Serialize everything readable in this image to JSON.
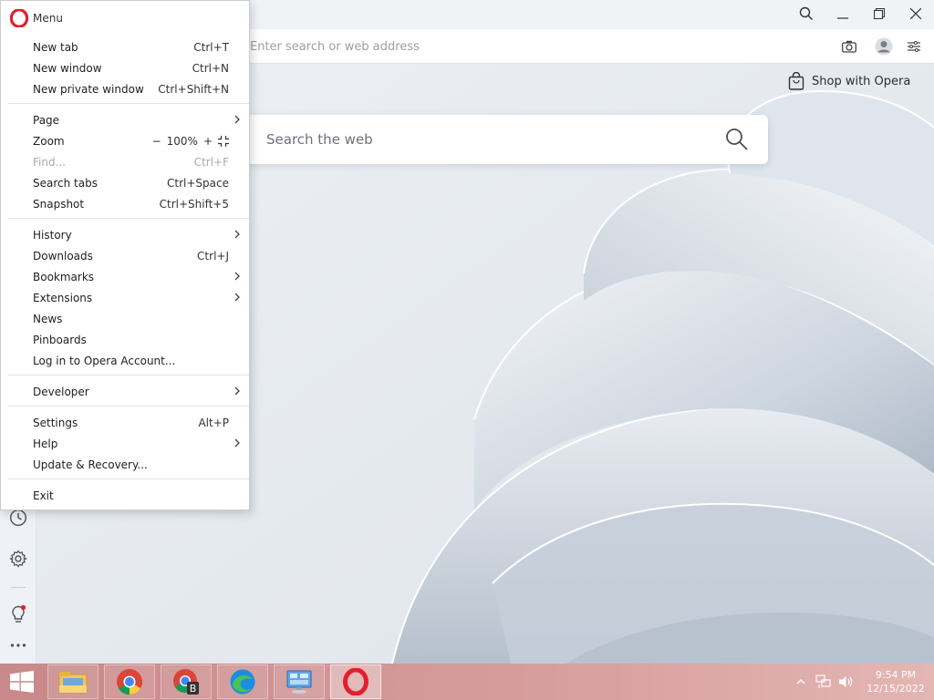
{
  "browser": {
    "address_placeholder": "Enter search or web address",
    "shop_label": "Shop with Opera",
    "search_placeholder": "Search the web"
  },
  "menu": {
    "title": "Menu",
    "items": [
      {
        "label": "New tab",
        "shortcut": "Ctrl+T"
      },
      {
        "label": "New window",
        "shortcut": "Ctrl+N"
      },
      {
        "label": "New private window",
        "shortcut": "Ctrl+Shift+N"
      },
      {
        "label": "Page",
        "submenu": true
      },
      {
        "label": "Zoom",
        "zoom_level": "100%"
      },
      {
        "label": "Find...",
        "shortcut": "Ctrl+F",
        "disabled": true
      },
      {
        "label": "Search tabs",
        "shortcut": "Ctrl+Space"
      },
      {
        "label": "Snapshot",
        "shortcut": "Ctrl+Shift+5"
      },
      {
        "label": "History",
        "submenu": true
      },
      {
        "label": "Downloads",
        "shortcut": "Ctrl+J"
      },
      {
        "label": "Bookmarks",
        "submenu": true
      },
      {
        "label": "Extensions",
        "submenu": true
      },
      {
        "label": "News"
      },
      {
        "label": "Pinboards"
      },
      {
        "label": "Log in to Opera Account..."
      },
      {
        "label": "Developer",
        "submenu": true
      },
      {
        "label": "Settings",
        "shortcut": "Alt+P"
      },
      {
        "label": "Help",
        "submenu": true
      },
      {
        "label": "Update & Recovery..."
      },
      {
        "label": "Exit"
      }
    ],
    "zoom_minus": "−",
    "zoom_plus": "+"
  },
  "taskbar": {
    "items": [
      "file-explorer-icon",
      "chrome-icon",
      "chrome-beta-icon",
      "edge-icon",
      "control-panel-icon",
      "opera-icon"
    ],
    "time": "9:54 PM",
    "date": "12/15/2022"
  },
  "colors": {
    "opera_red": "#e2202c",
    "notification_dot": "#e2202c"
  }
}
